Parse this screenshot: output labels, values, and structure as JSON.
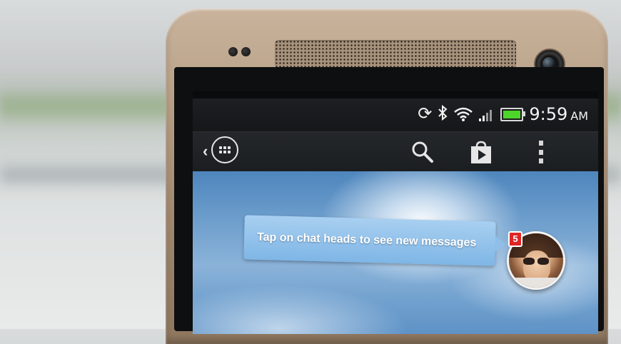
{
  "status_bar": {
    "time": "9:59",
    "ampm": "AM",
    "icons": [
      "sync-icon",
      "bluetooth-icon",
      "wifi-icon",
      "signal-icon",
      "battery-icon"
    ],
    "battery_color": "#4cd42b"
  },
  "action_bar": {
    "icons": [
      "back-chevron-icon",
      "app-drawer-icon",
      "search-icon",
      "play-store-icon",
      "overflow-menu-icon"
    ]
  },
  "chat": {
    "bubble_text": "Tap on chat heads to see new messages",
    "unread_count": "5",
    "badge_color": "#e02424"
  }
}
